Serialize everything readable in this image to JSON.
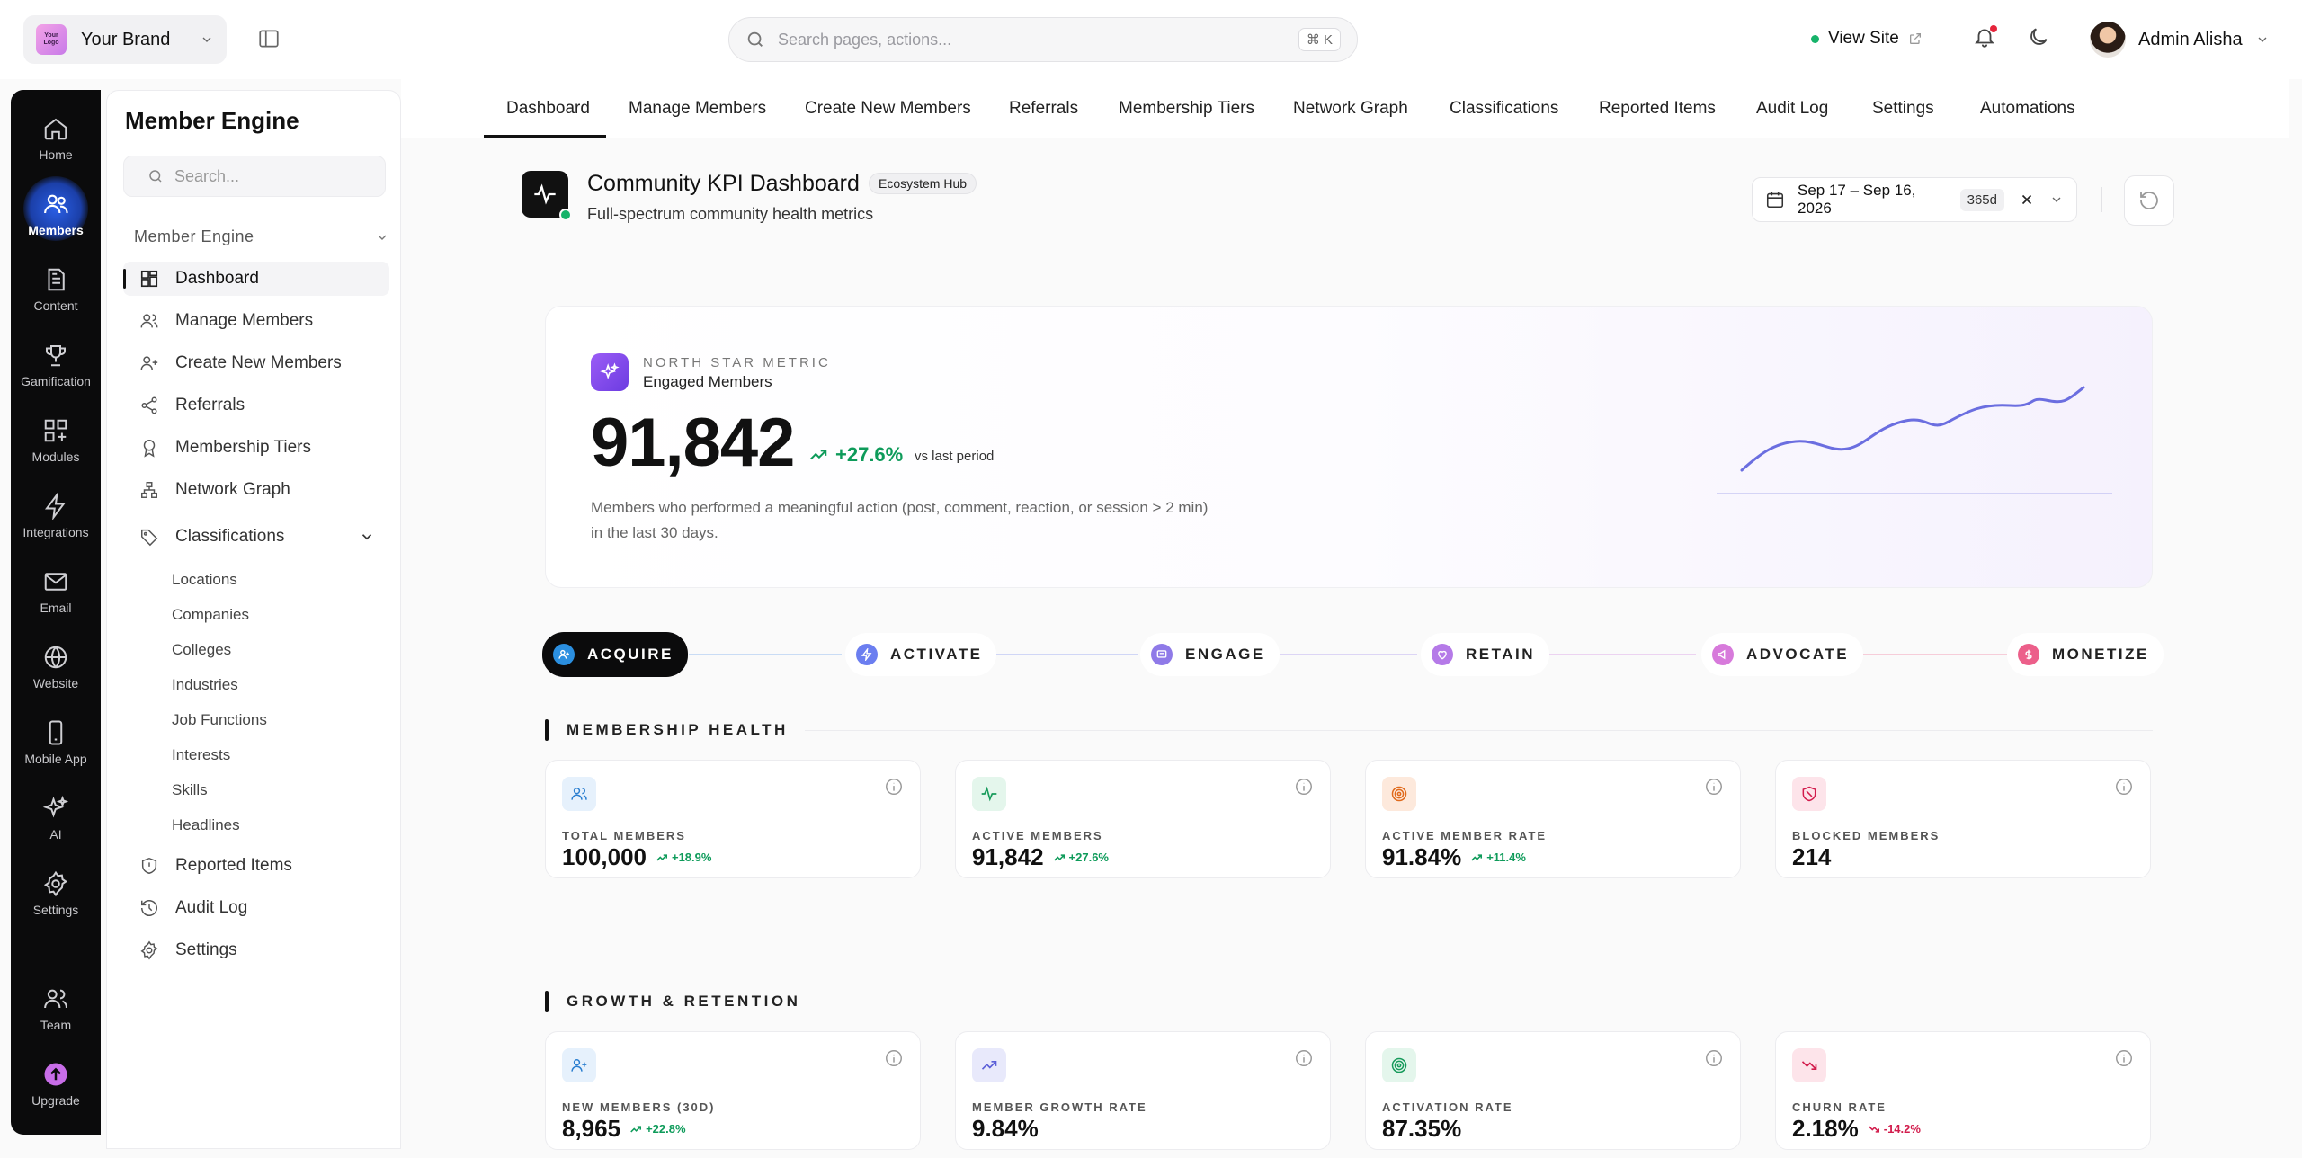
{
  "topbar": {
    "brand_logo_text": "Your Logo",
    "brand_name": "Your Brand",
    "search_placeholder": "Search pages, actions...",
    "search_shortcut": "⌘ K",
    "view_site": "View Site",
    "user_name": "Admin Alisha"
  },
  "rail": {
    "items": [
      {
        "label": "Home",
        "icon": "home-icon"
      },
      {
        "label": "Members",
        "icon": "members-icon",
        "active": true
      },
      {
        "label": "Content",
        "icon": "document-icon"
      },
      {
        "label": "Gamification",
        "icon": "trophy-icon"
      },
      {
        "label": "Modules",
        "icon": "grid-plus-icon"
      },
      {
        "label": "Integrations",
        "icon": "bolt-icon"
      },
      {
        "label": "Email",
        "icon": "mail-icon"
      },
      {
        "label": "Website",
        "icon": "globe-icon"
      },
      {
        "label": "Mobile App",
        "icon": "phone-icon"
      },
      {
        "label": "AI",
        "icon": "sparkles-icon"
      },
      {
        "label": "Settings",
        "icon": "gear-icon"
      },
      {
        "label": "Team",
        "icon": "team-icon"
      },
      {
        "label": "Upgrade",
        "icon": "upgrade-icon"
      }
    ]
  },
  "sidebar": {
    "title": "Member Engine",
    "search_placeholder": "Search...",
    "group_label": "Member Engine",
    "items": [
      {
        "label": "Dashboard",
        "icon": "dashboard-icon",
        "active": true
      },
      {
        "label": "Manage Members",
        "icon": "users-icon"
      },
      {
        "label": "Create New Members",
        "icon": "user-plus-icon"
      },
      {
        "label": "Referrals",
        "icon": "share-icon"
      },
      {
        "label": "Membership Tiers",
        "icon": "badge-icon"
      },
      {
        "label": "Network Graph",
        "icon": "network-icon"
      },
      {
        "label": "Classifications",
        "icon": "tag-icon"
      }
    ],
    "sub_items": [
      "Locations",
      "Companies",
      "Colleges",
      "Industries",
      "Job Functions",
      "Interests",
      "Skills",
      "Headlines"
    ],
    "bottom_items": [
      {
        "label": "Reported Items",
        "icon": "shield-icon"
      },
      {
        "label": "Audit Log",
        "icon": "history-icon"
      },
      {
        "label": "Settings",
        "icon": "gear-icon"
      }
    ]
  },
  "tabs": [
    "Dashboard",
    "Manage Members",
    "Create New Members",
    "Referrals",
    "Membership Tiers",
    "Network Graph",
    "Classifications",
    "Reported Items",
    "Audit Log",
    "Settings",
    "Automations"
  ],
  "header": {
    "title": "Community KPI Dashboard",
    "tag": "Ecosystem Hub",
    "subtitle": "Full-spectrum community health metrics",
    "date_range": "Sep 17 – Sep 16, 2026",
    "range_days": "365d"
  },
  "north_star": {
    "kicker": "NORTH STAR METRIC",
    "name": "Engaged Members",
    "value": "91,842",
    "delta": "+27.6%",
    "delta_suffix": "vs last period",
    "description": "Members who performed a meaningful action (post, comment, reaction, or session > 2 min) in the last 30 days.",
    "spark_color": "#6b6ee0"
  },
  "funnel": [
    {
      "label": "ACQUIRE",
      "color": "#2b8fe0",
      "active": true
    },
    {
      "label": "ACTIVATE",
      "color": "#6b7ef0"
    },
    {
      "label": "ENGAGE",
      "color": "#8f7ae8"
    },
    {
      "label": "RETAIN",
      "color": "#b57ae8"
    },
    {
      "label": "ADVOCATE",
      "color": "#d77adb"
    },
    {
      "label": "MONETIZE",
      "color": "#ec5f8a"
    }
  ],
  "sections": {
    "health": {
      "title": "MEMBERSHIP HEALTH",
      "cards": [
        {
          "label": "TOTAL MEMBERS",
          "value": "100,000",
          "change": "+18.9%",
          "trend": "up",
          "icon": "users-icon",
          "tint": "#e6f1fc",
          "ink": "#2b7fd0"
        },
        {
          "label": "ACTIVE MEMBERS",
          "value": "91,842",
          "change": "+27.6%",
          "trend": "up",
          "icon": "activity-icon",
          "tint": "#e4f6ec",
          "ink": "#169a5a"
        },
        {
          "label": "ACTIVE MEMBER RATE",
          "value": "91.84%",
          "change": "+11.4%",
          "trend": "up",
          "icon": "target-icon",
          "tint": "#fde9dc",
          "ink": "#e06a1c"
        },
        {
          "label": "BLOCKED MEMBERS",
          "value": "214",
          "change": "",
          "trend": "",
          "icon": "ban-icon",
          "tint": "#fde4ea",
          "ink": "#d21c4c"
        }
      ]
    },
    "growth": {
      "title": "GROWTH & RETENTION",
      "cards": [
        {
          "label": "NEW MEMBERS (30D)",
          "value": "8,965",
          "change": "+22.8%",
          "trend": "up",
          "icon": "user-plus-icon",
          "tint": "#e6f1fc",
          "ink": "#2b7fd0"
        },
        {
          "label": "MEMBER GROWTH RATE",
          "value": "9.84%",
          "change": "",
          "trend": "",
          "icon": "trend-up-icon",
          "tint": "#e8e9fb",
          "ink": "#5b5fd8"
        },
        {
          "label": "ACTIVATION RATE",
          "value": "87.35%",
          "change": "",
          "trend": "",
          "icon": "target-icon",
          "tint": "#e4f6ec",
          "ink": "#169a5a"
        },
        {
          "label": "CHURN RATE",
          "value": "2.18%",
          "change": "-14.2%",
          "trend": "down",
          "icon": "trend-down-icon",
          "tint": "#fde4ea",
          "ink": "#d21c4c"
        }
      ]
    }
  }
}
